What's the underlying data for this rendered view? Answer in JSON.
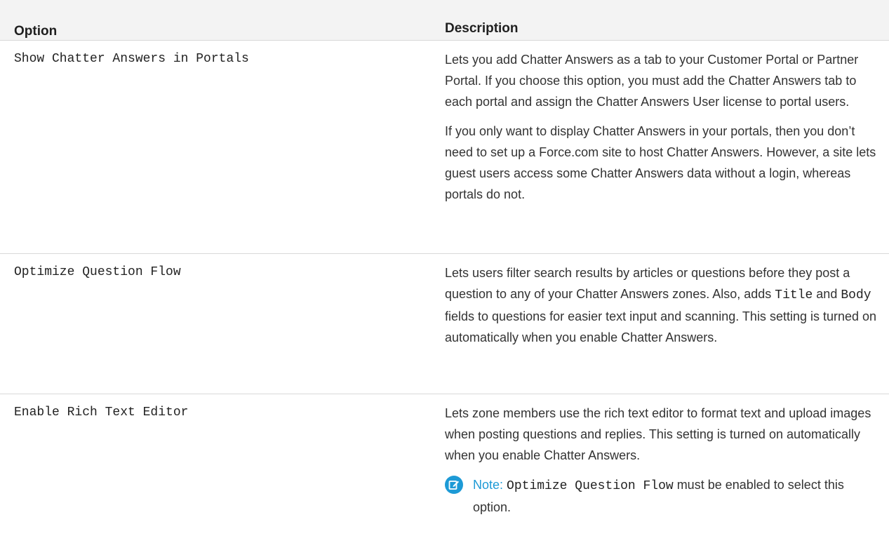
{
  "header": {
    "option": "Option",
    "description": "Description"
  },
  "rows": [
    {
      "option": "Show Chatter Answers in Portals",
      "desc_p1": "Lets you add Chatter Answers as a tab to your Customer Portal or Partner Portal. If you choose this option, you must add the Chatter Answers tab to each portal and assign the Chatter Answers User license to portal users.",
      "desc_p2": "If you only want to display Chatter Answers in your portals, then you don’t need to set up a Force.com site to host Chatter Answers. However, a site lets guest users access some Chatter Answers data without a login, whereas portals do not."
    },
    {
      "option": "Optimize Question Flow",
      "desc_a": "Lets users filter search results by articles or questions before they post a question to any of your Chatter Answers zones. Also, adds ",
      "code_title": "Title",
      "desc_and": " and ",
      "code_body": "Body",
      "desc_b": " fields to questions for easier text input and scanning. This setting is turned on automatically when you enable Chatter Answers."
    },
    {
      "option": "Enable Rich Text Editor",
      "desc_p1": "Lets zone members use the rich text editor to format text and upload images when posting questions and replies. This setting is turned on automatically when you enable Chatter Answers.",
      "note_label": "Note:",
      "note_code": "Optimize Question Flow",
      "note_text": " must be enabled to select this option."
    }
  ],
  "colors": {
    "accent": "#1d9ad6",
    "header_bg": "#f3f3f3",
    "divider": "#d9d9d9"
  },
  "icons": {
    "note": "note-edit-icon"
  }
}
